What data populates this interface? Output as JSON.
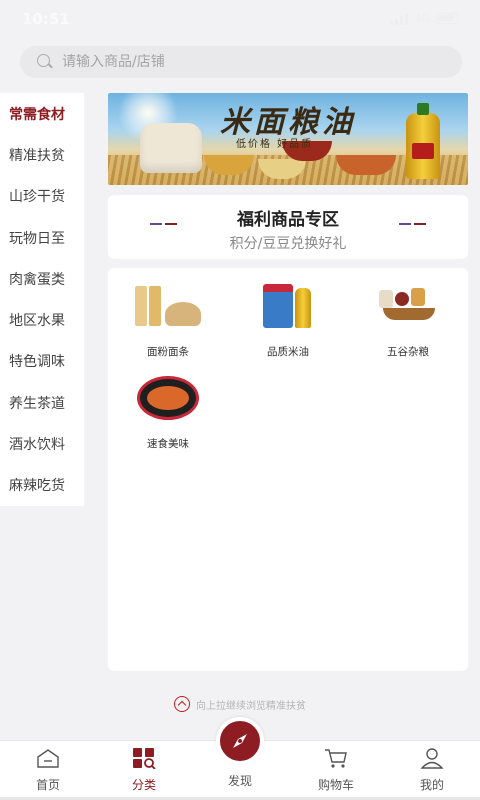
{
  "status": {
    "time": "10:51",
    "network": "4G"
  },
  "search": {
    "placeholder": "请输入商品/店铺"
  },
  "sidebar": {
    "items": [
      {
        "label": "常需食材"
      },
      {
        "label": "精准扶贫"
      },
      {
        "label": "山珍干货"
      },
      {
        "label": "玩物日至"
      },
      {
        "label": "肉禽蛋类"
      },
      {
        "label": "地区水果"
      },
      {
        "label": "特色调味"
      },
      {
        "label": "养生茶道"
      },
      {
        "label": "酒水饮料"
      },
      {
        "label": "麻辣吃货"
      }
    ],
    "active_index": 0
  },
  "banner": {
    "title": "米面粮油",
    "subtitle": "低价格 好品质"
  },
  "welfare": {
    "title": "福利商品专区",
    "subtitle": "积分/豆豆兑换好礼"
  },
  "categories": [
    {
      "label": "面粉面条"
    },
    {
      "label": "品质米油"
    },
    {
      "label": "五谷杂粮"
    },
    {
      "label": "速食美味"
    }
  ],
  "pull_tip": "向上拉继续浏览精准扶贫",
  "tabs": [
    {
      "label": "首页"
    },
    {
      "label": "分类"
    },
    {
      "label": "发现"
    },
    {
      "label": "购物车"
    },
    {
      "label": "我的"
    }
  ],
  "active_tab": 1,
  "colors": {
    "accent": "#8d1c23",
    "background": "#f2f2f4",
    "accent_purple": "#6a4a8c"
  }
}
